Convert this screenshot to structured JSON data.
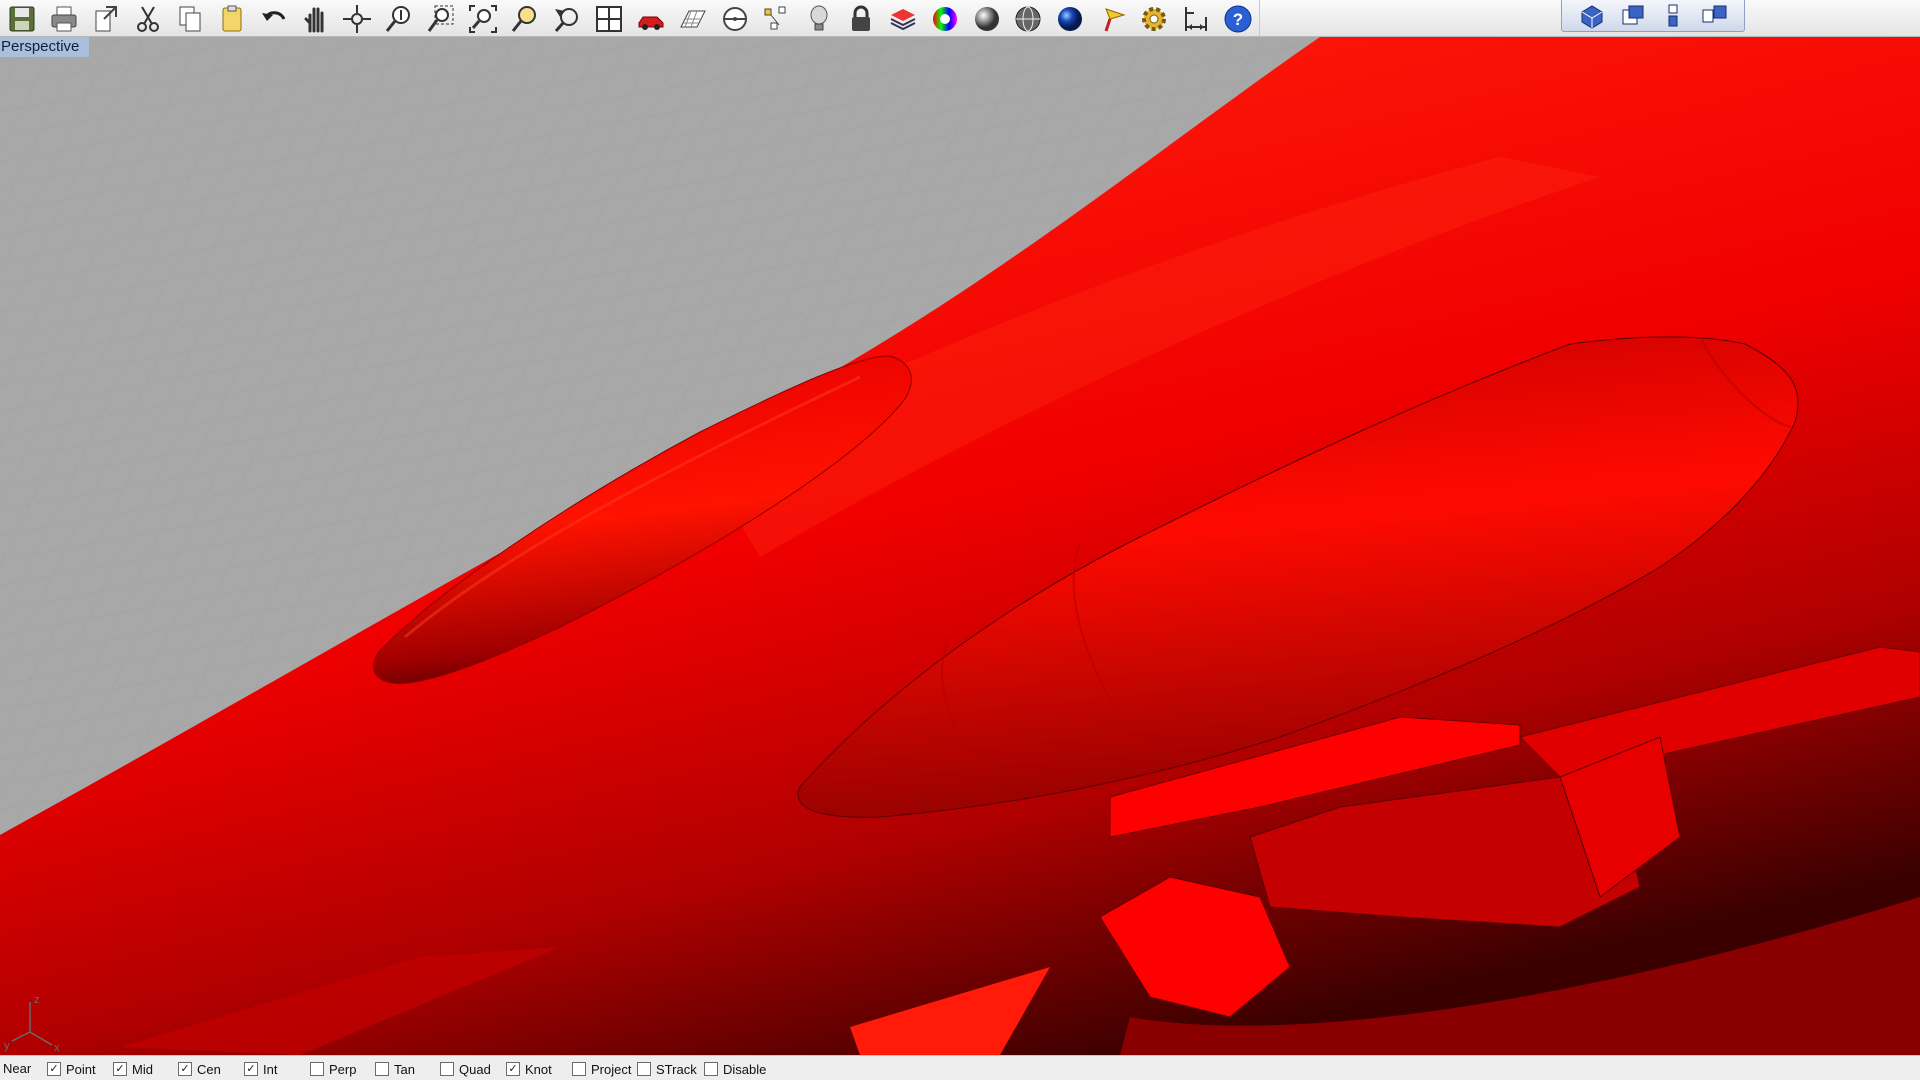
{
  "toolbar": {
    "buttons": [
      {
        "icon": "save-icon"
      },
      {
        "icon": "print-icon"
      },
      {
        "icon": "export-icon"
      },
      {
        "icon": "cut-icon"
      },
      {
        "icon": "copy-icon"
      },
      {
        "icon": "paste-icon"
      },
      {
        "icon": "undo-icon"
      },
      {
        "icon": "pan-icon"
      },
      {
        "icon": "rotate-view-icon"
      },
      {
        "icon": "zoom-dynamic-icon"
      },
      {
        "icon": "zoom-window-icon"
      },
      {
        "icon": "zoom-extents-icon"
      },
      {
        "icon": "zoom-selected-icon"
      },
      {
        "icon": "undo-view-icon"
      },
      {
        "icon": "four-viewports-icon"
      },
      {
        "icon": "car-icon"
      },
      {
        "icon": "grid-plane-icon"
      },
      {
        "icon": "cplane-icon"
      },
      {
        "icon": "select-points-icon"
      },
      {
        "icon": "light-bulb-icon"
      },
      {
        "icon": "lock-icon"
      },
      {
        "icon": "layer-book-icon"
      },
      {
        "icon": "color-wheel-icon"
      },
      {
        "icon": "shaded-sphere-icon"
      },
      {
        "icon": "wireframe-sphere-icon"
      },
      {
        "icon": "rendered-sphere-icon"
      },
      {
        "icon": "render-icon"
      },
      {
        "icon": "options-gear-icon"
      },
      {
        "icon": "dimension-icon"
      },
      {
        "icon": "help-icon"
      }
    ],
    "viewport_switch": [
      {
        "icon": "perspective-view-icon"
      },
      {
        "icon": "top-view-icon"
      },
      {
        "icon": "front-view-icon"
      },
      {
        "icon": "right-view-icon"
      }
    ]
  },
  "viewport": {
    "title": "Perspective",
    "model_color": "#ff0000",
    "background_color": "#a8a8a8",
    "axes": {
      "x": "x",
      "y": "y",
      "z": "z"
    }
  },
  "osnap": {
    "near_label": "Near",
    "items": [
      {
        "label": "Point",
        "checked": true
      },
      {
        "label": "Mid",
        "checked": true
      },
      {
        "label": "Cen",
        "checked": true
      },
      {
        "label": "Int",
        "checked": true
      },
      {
        "label": "Perp",
        "checked": false
      },
      {
        "label": "Tan",
        "checked": false
      },
      {
        "label": "Quad",
        "checked": false
      },
      {
        "label": "Knot",
        "checked": true
      },
      {
        "label": "Project",
        "checked": false
      },
      {
        "label": "STrack",
        "checked": false
      },
      {
        "label": "Disable",
        "checked": false
      }
    ]
  }
}
